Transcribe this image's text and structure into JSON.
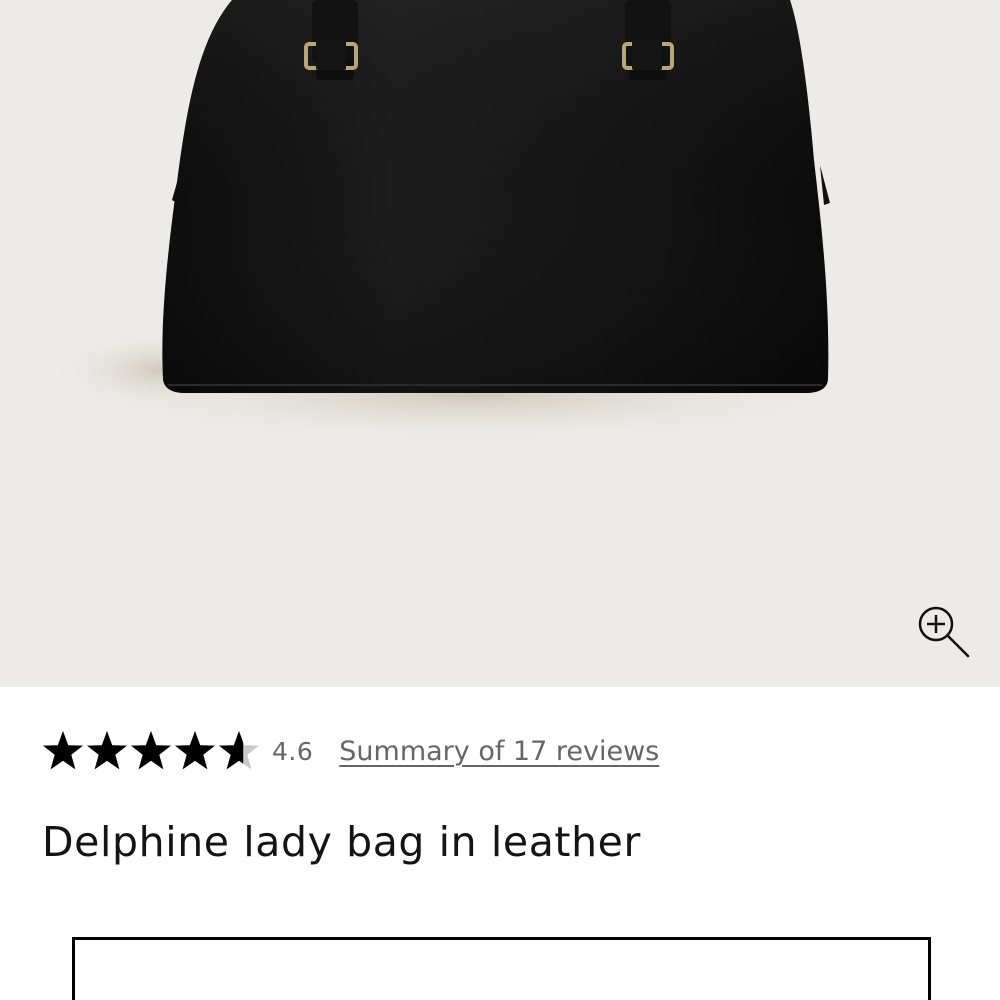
{
  "product_image": {
    "alt": "Delphine lady bag in leather",
    "background_color": "#ecebe7",
    "bag_color": "#141414"
  },
  "zoom": {
    "icon": "zoom-in-icon"
  },
  "rating": {
    "value": "4.6",
    "stars": 4.6,
    "max_stars": 5,
    "reviews_link_label": "Summary of 17 reviews",
    "star_color": "#000000",
    "empty_star_color": "#c8c8c8"
  },
  "product": {
    "title": "Delphine lady bag in leather"
  }
}
